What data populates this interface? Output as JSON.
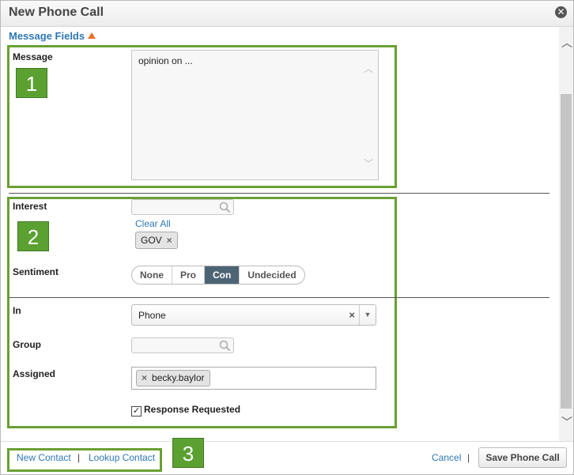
{
  "dialog": {
    "title": "New Phone Call"
  },
  "section": {
    "toggle_label": "Message Fields"
  },
  "message": {
    "label": "Message",
    "value": "opinion on ..."
  },
  "interest": {
    "label": "Interest",
    "clear_all": "Clear All",
    "tags": [
      "GOV"
    ]
  },
  "sentiment": {
    "label": "Sentiment",
    "options": [
      "None",
      "Pro",
      "Con",
      "Undecided"
    ],
    "selected": "Con"
  },
  "in_field": {
    "label": "In",
    "value": "Phone"
  },
  "group": {
    "label": "Group"
  },
  "assigned": {
    "label": "Assigned",
    "tags": [
      "becky.baylor"
    ]
  },
  "response": {
    "label": "Response Requested",
    "checked": true
  },
  "footer": {
    "new_contact": "New Contact",
    "separator": "|",
    "lookup_contact": "Lookup Contact",
    "cancel": "Cancel",
    "save": "Save Phone Call"
  },
  "annotations": {
    "badge1": "1",
    "badge2": "2",
    "badge3": "3"
  },
  "colors": {
    "highlight_box": "#6aa033",
    "badge_bg": "#5aa132",
    "link": "#2e78b5",
    "active_segment": "#4d6474"
  }
}
